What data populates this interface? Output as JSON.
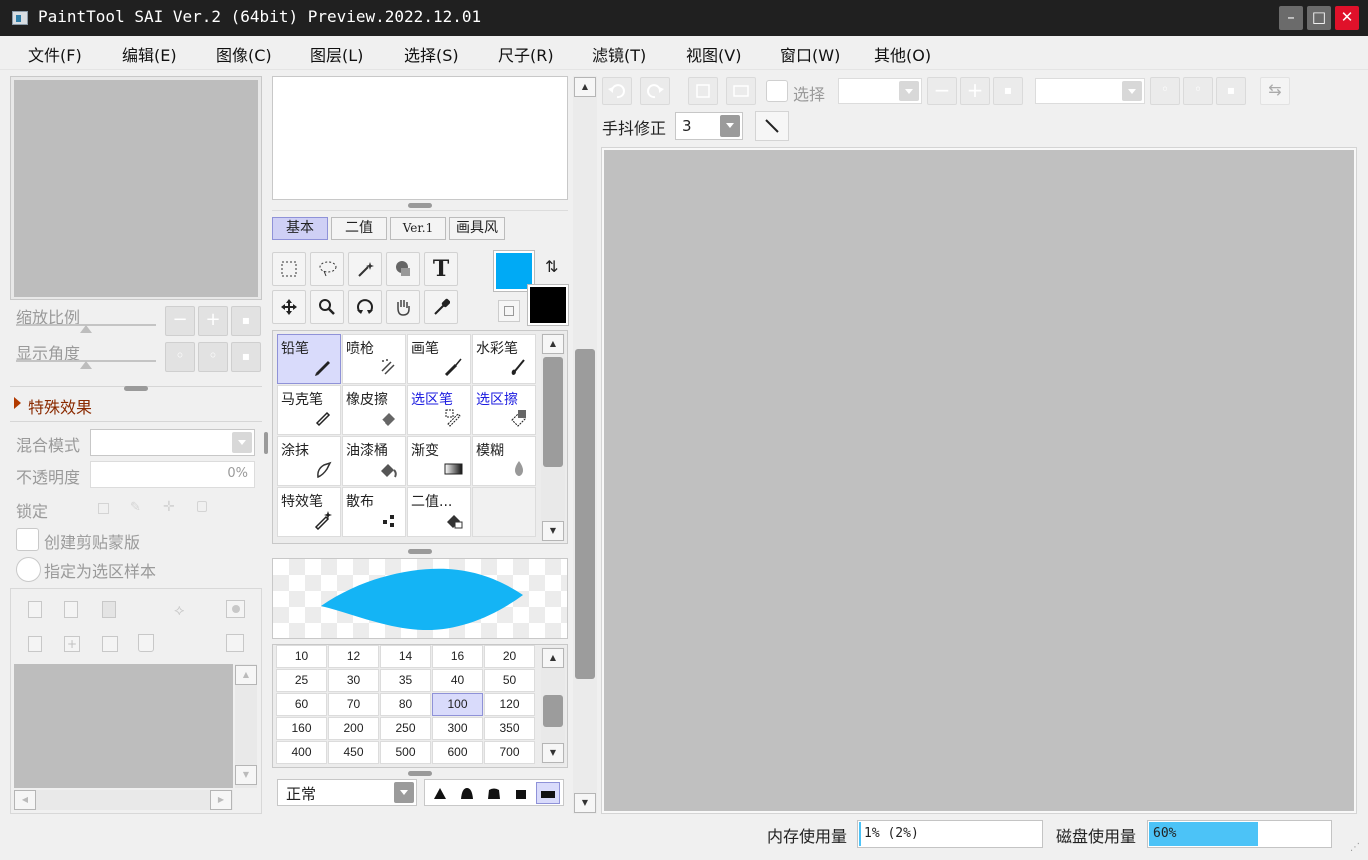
{
  "window": {
    "title": "PaintTool SAI Ver.2 (64bit) Preview.2022.12.01",
    "controls": {
      "minimize": "–",
      "maximize": "□",
      "close": "✕"
    }
  },
  "menu": [
    "文件(F)",
    "编辑(E)",
    "图像(C)",
    "图层(L)",
    "选择(S)",
    "尺子(R)",
    "滤镜(T)",
    "视图(V)",
    "窗口(W)",
    "其他(O)"
  ],
  "navigator": {
    "zoom_label": "缩放比例",
    "angle_label": "显示角度",
    "zoom_buttons": [
      "−",
      "+",
      "▪"
    ],
    "angle_buttons": [
      "◦",
      "◦",
      "▪"
    ]
  },
  "layer_panel": {
    "special_effects": "特殊效果",
    "blend_mode_label": "混合模式",
    "opacity_label": "不透明度",
    "opacity_value": "0%",
    "lock_label": "锁定",
    "clip_mask": "创建剪贴蒙版",
    "selection_source": "指定为选区样本"
  },
  "tool_panel": {
    "tabs": [
      "基本",
      "二值",
      "Ver.1",
      "画具风"
    ],
    "selected_tab": 0,
    "tools": [
      "select-rect-icon",
      "lasso-icon",
      "magic-wand-icon",
      "shape-icon",
      "text-icon",
      "move-icon",
      "zoom-icon",
      "rotate-icon",
      "hand-icon",
      "eyedropper-icon"
    ],
    "text_tool_glyph": "T",
    "foreground_color": "#00aaf5",
    "background_color": "#000000"
  },
  "brushes": [
    {
      "label": "铅笔",
      "selected": true,
      "blue": false
    },
    {
      "label": "喷枪",
      "selected": false,
      "blue": false
    },
    {
      "label": "画笔",
      "selected": false,
      "blue": false
    },
    {
      "label": "水彩笔",
      "selected": false,
      "blue": false
    },
    {
      "label": "马克笔",
      "selected": false,
      "blue": false
    },
    {
      "label": "橡皮擦",
      "selected": false,
      "blue": false
    },
    {
      "label": "选区笔",
      "selected": false,
      "blue": true
    },
    {
      "label": "选区擦",
      "selected": false,
      "blue": true
    },
    {
      "label": "涂抹",
      "selected": false,
      "blue": false
    },
    {
      "label": "油漆桶",
      "selected": false,
      "blue": false
    },
    {
      "label": "渐变",
      "selected": false,
      "blue": false
    },
    {
      "label": "模糊",
      "selected": false,
      "blue": false
    },
    {
      "label": "特效笔",
      "selected": false,
      "blue": false
    },
    {
      "label": "散布",
      "selected": false,
      "blue": false
    },
    {
      "label": "二值...",
      "selected": false,
      "blue": false
    },
    {
      "label": "",
      "selected": false,
      "blue": false
    }
  ],
  "brush_sizes": [
    "10",
    "12",
    "14",
    "16",
    "20",
    "25",
    "30",
    "35",
    "40",
    "50",
    "60",
    "70",
    "80",
    "100",
    "120",
    "160",
    "200",
    "250",
    "300",
    "350",
    "400",
    "450",
    "500",
    "600",
    "700"
  ],
  "selected_size": "100",
  "brush_blend_mode": "正常",
  "brush_shapes_selected": 4,
  "toolbar": {
    "select_label": "选择",
    "stabilizer_label": "手抖修正",
    "stabilizer_value": "3"
  },
  "status": {
    "memory_label": "内存使用量",
    "memory_value": "1% (2%)",
    "memory_fraction": 0.01,
    "disk_label": "磁盘使用量",
    "disk_value": "60%",
    "disk_fraction": 0.6,
    "disk_color": "#4cc3f7"
  }
}
